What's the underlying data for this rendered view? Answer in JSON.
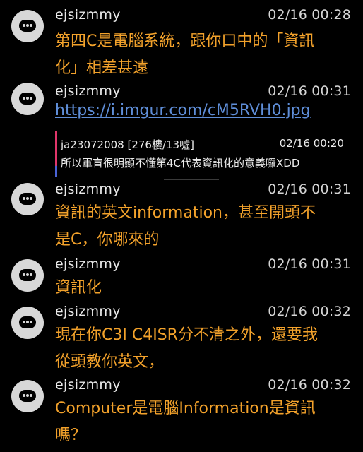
{
  "comments": [
    {
      "user": "ejsizmmy",
      "time": "02/16 00:28",
      "line1": "第四C是電腦系統，跟你口中的「資訊",
      "line2": "化」相差甚遠"
    },
    {
      "user": "ejsizmmy",
      "time": "02/16 00:31",
      "link": "https://i.imgur.com/cM5RVH0.jpg",
      "quote": {
        "user": "ja23072008 [276樓/13噓]",
        "time": "02/16 00:20",
        "text": "所以軍盲很明顯不懂第4C代表資訊化的意義囉XDD"
      }
    },
    {
      "user": "ejsizmmy",
      "time": "02/16 00:31",
      "line1": "資訊的英文information，甚至開頭不",
      "line2": "是C，你哪來的"
    },
    {
      "user": "ejsizmmy",
      "time": "02/16 00:31",
      "line1": "資訊化"
    },
    {
      "user": "ejsizmmy",
      "time": "02/16 00:32",
      "line1": "現在你C3I C4ISR分不清之外，還要我",
      "line2": "從頭教你英文，"
    },
    {
      "user": "ejsizmmy",
      "time": "02/16 00:32",
      "line1": "Computer是電腦Information是資訊",
      "line2": "嗎？"
    }
  ],
  "colors": {
    "background": "#000000",
    "comment_text": "#f3a22b",
    "link": "#5f8ed8",
    "username": "#e9e9e9",
    "avatar": "#d8d8d8"
  },
  "icons": {
    "avatar": "chat-bubble-icon"
  }
}
